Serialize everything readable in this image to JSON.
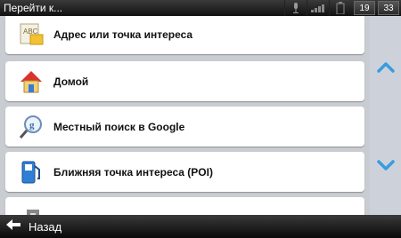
{
  "header": {
    "title": "Перейти к...",
    "time_hours": "19",
    "time_minutes": "33"
  },
  "items": [
    {
      "label": "Адрес или точка интереса",
      "icon": "address-icon"
    },
    {
      "label": "Домой",
      "icon": "home-icon"
    },
    {
      "label": "Местный поиск в Google",
      "icon": "google-search-icon"
    },
    {
      "label": "Ближняя точка интереса (POI)",
      "icon": "fuel-pump-icon"
    }
  ],
  "footer": {
    "back_label": "Назад"
  },
  "colors": {
    "accent": "#3a9be0",
    "list_bg": "#c9ccd1"
  }
}
